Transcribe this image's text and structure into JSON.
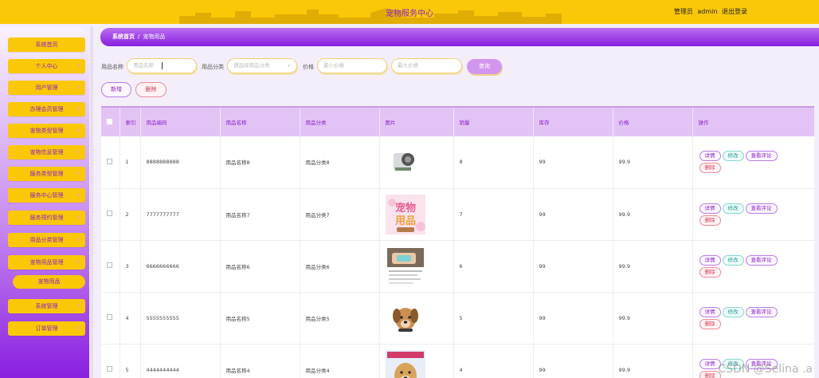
{
  "header": {
    "title": "宠物服务中心",
    "role_label": "管理员",
    "username": "admin",
    "logout_label": "退出登录"
  },
  "sidebar": {
    "items": [
      {
        "label": "系统首页"
      },
      {
        "label": "个人中心"
      },
      {
        "label": "用户管理"
      },
      {
        "label": "办理会员管理"
      },
      {
        "label": "宠物类型管理"
      },
      {
        "label": "宠物信息管理"
      },
      {
        "label": "服务类型管理"
      },
      {
        "label": "服务中心管理"
      },
      {
        "label": "服务预约管理"
      },
      {
        "label": "用品分类管理"
      },
      {
        "label": "宠物用品管理"
      },
      {
        "label": "系统管理"
      },
      {
        "label": "订单管理"
      }
    ],
    "sub_item": "宠物用品"
  },
  "breadcrumb": {
    "home": "系统首页",
    "separator": "/",
    "current": "宠物用品"
  },
  "search": {
    "name_label": "用品名称",
    "name_placeholder": "用品名称",
    "category_label": "用品分类",
    "category_placeholder": "请选择用品分类",
    "price_label": "价格",
    "min_price_placeholder": "最小价格",
    "max_price_placeholder": "最大价格",
    "query_button": "查询"
  },
  "actions": {
    "add_button": "新增",
    "delete_button": "删除"
  },
  "table": {
    "columns": [
      "索引",
      "用品编码",
      "用品名称",
      "用品分类",
      "图片",
      "销量",
      "库存",
      "价格",
      "操作"
    ],
    "rows": [
      {
        "index": "1",
        "code": "8888888888",
        "name": "用品名称8",
        "category": "用品分类8",
        "sales": "8",
        "stock": "99",
        "price": "99.9"
      },
      {
        "index": "2",
        "code": "7777777777",
        "name": "用品名称7",
        "category": "用品分类7",
        "sales": "7",
        "stock": "99",
        "price": "99.9"
      },
      {
        "index": "3",
        "code": "6666666666",
        "name": "用品名称6",
        "category": "用品分类6",
        "sales": "6",
        "stock": "99",
        "price": "99.9"
      },
      {
        "index": "4",
        "code": "5555555555",
        "name": "用品名称5",
        "category": "用品分类5",
        "sales": "5",
        "stock": "99",
        "price": "99.9"
      },
      {
        "index": "5",
        "code": "4444444444",
        "name": "用品名称4",
        "category": "用品分类4",
        "sales": "4",
        "stock": "99",
        "price": "99.9"
      }
    ],
    "ops": {
      "detail": "详情",
      "edit": "修改",
      "review": "查看评论",
      "remove": "删除"
    }
  },
  "images": {
    "row2_banner_top": "宠物",
    "row2_banner_bottom": "用品"
  },
  "watermark": "CSDN @Selina .a",
  "colors": {
    "header_yellow": "#fbc807",
    "accent_purple": "#8a1fc9",
    "table_header": "#e3c3f6"
  }
}
